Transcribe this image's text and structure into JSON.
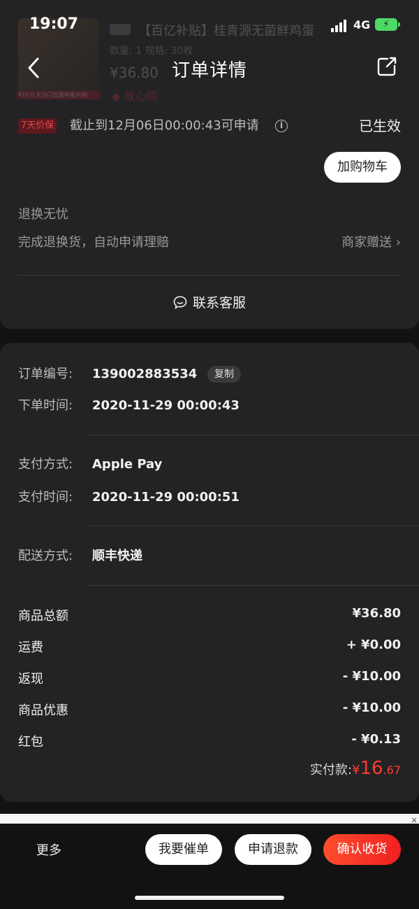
{
  "status_bar": {
    "time": "19:07",
    "network": "4G"
  },
  "product_ghost": {
    "thumb_band": "¥10.0  无沙门氏菌鸡蛋30枚",
    "title": "【百亿补贴】桂青源无菌鲜鸡蛋",
    "spec": "数量: 1  规格: 30枚",
    "price": "¥36.80",
    "badge": "◆ 放心购"
  },
  "nav": {
    "title": "订单详情"
  },
  "price_protect": {
    "tag": "7天价保",
    "text": "截止到12月06日00:00:43可申请",
    "status": "已生效"
  },
  "cart_button": "加购物车",
  "return_service": {
    "title": "退换无忧",
    "desc": "完成退换货，自动申请理赔",
    "right": "商家赠送 ›"
  },
  "customer_service": "联系客服",
  "order": {
    "number_label": "订单编号:",
    "number": "139002883534",
    "copy": "复制",
    "time_label": "下单时间:",
    "time": "2020-11-29 00:00:43",
    "pay_method_label": "支付方式:",
    "pay_method": "Apple Pay",
    "pay_time_label": "支付时间:",
    "pay_time": "2020-11-29 00:00:51",
    "delivery_label": "配送方式:",
    "delivery": "顺丰快递"
  },
  "fees": [
    {
      "label": "商品总额",
      "value": "¥36.80"
    },
    {
      "label": "运费",
      "value": "+ ¥0.00"
    },
    {
      "label": "返现",
      "value": "- ¥10.00"
    },
    {
      "label": "商品优惠",
      "value": "- ¥10.00"
    },
    {
      "label": "红包",
      "value": "- ¥0.13"
    }
  ],
  "paid": {
    "label": "实付款:",
    "currency": "¥",
    "int": "16",
    "dec": ".67"
  },
  "bottom": {
    "close": "×",
    "more": "更多",
    "urge": "我要催单",
    "refund": "申请退款",
    "confirm": "确认收货"
  },
  "colors": {
    "accent": "#ff3b30",
    "battery": "#4cd964"
  }
}
